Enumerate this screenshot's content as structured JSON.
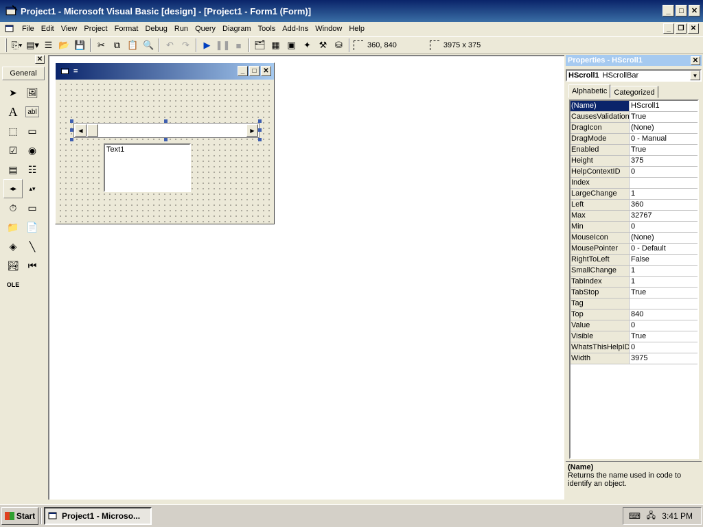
{
  "window": {
    "title": "Project1 - Microsoft Visual Basic [design] - [Project1 - Form1 (Form)]"
  },
  "menu": [
    "File",
    "Edit",
    "View",
    "Project",
    "Format",
    "Debug",
    "Run",
    "Query",
    "Diagram",
    "Tools",
    "Add-Ins",
    "Window",
    "Help"
  ],
  "toolbar": {
    "position": "360, 840",
    "size": "3975 x 375"
  },
  "toolbox": {
    "tab": "General"
  },
  "form": {
    "title": "=",
    "textbox_text": "Text1"
  },
  "properties": {
    "title": "Properties - HScroll1",
    "object_name": "HScroll1",
    "object_type": "HScrollBar",
    "tabs": [
      "Alphabetic",
      "Categorized"
    ],
    "rows": [
      {
        "name": "(Name)",
        "value": "HScroll1"
      },
      {
        "name": "CausesValidation",
        "value": "True"
      },
      {
        "name": "DragIcon",
        "value": "(None)"
      },
      {
        "name": "DragMode",
        "value": "0 - Manual"
      },
      {
        "name": "Enabled",
        "value": "True"
      },
      {
        "name": "Height",
        "value": "375"
      },
      {
        "name": "HelpContextID",
        "value": "0"
      },
      {
        "name": "Index",
        "value": ""
      },
      {
        "name": "LargeChange",
        "value": "1"
      },
      {
        "name": "Left",
        "value": "360"
      },
      {
        "name": "Max",
        "value": "32767"
      },
      {
        "name": "Min",
        "value": "0"
      },
      {
        "name": "MouseIcon",
        "value": "(None)"
      },
      {
        "name": "MousePointer",
        "value": "0 - Default"
      },
      {
        "name": "RightToLeft",
        "value": "False"
      },
      {
        "name": "SmallChange",
        "value": "1"
      },
      {
        "name": "TabIndex",
        "value": "1"
      },
      {
        "name": "TabStop",
        "value": "True"
      },
      {
        "name": "Tag",
        "value": ""
      },
      {
        "name": "Top",
        "value": "840"
      },
      {
        "name": "Value",
        "value": "0"
      },
      {
        "name": "Visible",
        "value": "True"
      },
      {
        "name": "WhatsThisHelpID",
        "value": "0"
      },
      {
        "name": "Width",
        "value": "3975"
      }
    ],
    "desc_title": "(Name)",
    "desc_text": "Returns the name used in code to identify an object."
  },
  "taskbar": {
    "start": "Start",
    "task": "Project1 - Microso...",
    "clock": "3:41 PM"
  }
}
